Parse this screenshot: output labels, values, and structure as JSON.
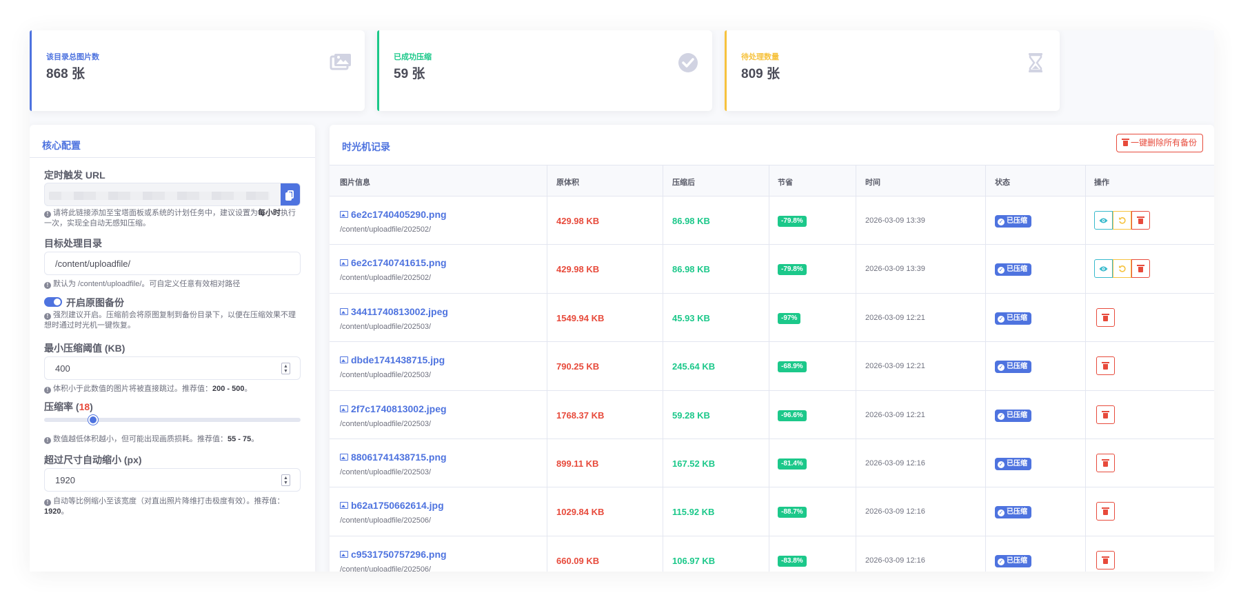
{
  "stats": [
    {
      "label": "该目录总图片数",
      "value": "868 张",
      "color": "#4e73df",
      "icon": "images-icon"
    },
    {
      "label": "已成功压缩",
      "value": "59 张",
      "color": "#1cc88a",
      "icon": "check-circle-icon"
    },
    {
      "label": "待处理数量",
      "value": "809 张",
      "color": "#f6c23e",
      "icon": "hourglass-icon"
    }
  ],
  "config": {
    "title": "核心配置",
    "cron_url": {
      "label": "定时触发 URL",
      "help_pre": "请将此链接添加至宝塔面板或系统的计划任务中，建议设置为",
      "help_bold": "每小时",
      "help_post": "执行一次，实现全自动无感知压缩。"
    },
    "target_dir": {
      "label": "目标处理目录",
      "value": "/content/uploadfile/",
      "help": "默认为 /content/uploadfile/。可自定义任意有效相对路径"
    },
    "backup": {
      "label": "开启原图备份",
      "enabled": true,
      "help": "强烈建议开启。压缩前会将原图复制到备份目录下，以便在压缩效果不理想时通过时光机一键恢复。"
    },
    "min_threshold": {
      "label": "最小压缩阈值 (KB)",
      "value": "400",
      "help_pre": "体积小于此数值的图片将被直接跳过。推荐值：",
      "help_bold": "200 - 500",
      "help_post": "。"
    },
    "rate": {
      "label_pre": "压缩率 (",
      "value": "18",
      "label_post": ")",
      "slider_fraction": 0.18,
      "help_pre": "数值越低体积越小，但可能出现画质损耗。推荐值：",
      "help_bold": "55 - 75",
      "help_post": "。"
    },
    "max_width": {
      "label": "超过尺寸自动缩小 (px)",
      "value": "1920",
      "help_pre": "自动等比例缩小至该宽度（对直出照片降维打击极度有效）。推荐值：",
      "help_bold": "1920",
      "help_post": "。"
    }
  },
  "history": {
    "title": "时光机记录",
    "delete_all_label": "一键删除所有备份",
    "columns": [
      "图片信息",
      "原体积",
      "压缩后",
      "节省",
      "时间",
      "状态",
      "操作"
    ],
    "rows": [
      {
        "name": "6e2c1740405290.png",
        "path": "/content/uploadfile/202502/",
        "orig": "429.98 KB",
        "comp": "86.98 KB",
        "save": "-79.8%",
        "time": "2026-03-09 13:39",
        "status": "已压缩",
        "has_backup": true
      },
      {
        "name": "6e2c1740741615.png",
        "path": "/content/uploadfile/202502/",
        "orig": "429.98 KB",
        "comp": "86.98 KB",
        "save": "-79.8%",
        "time": "2026-03-09 13:39",
        "status": "已压缩",
        "has_backup": true
      },
      {
        "name": "34411740813002.jpeg",
        "path": "/content/uploadfile/202503/",
        "orig": "1549.94 KB",
        "comp": "45.93 KB",
        "save": "-97%",
        "time": "2026-03-09 12:21",
        "status": "已压缩",
        "has_backup": false
      },
      {
        "name": "dbde1741438715.jpg",
        "path": "/content/uploadfile/202503/",
        "orig": "790.25 KB",
        "comp": "245.64 KB",
        "save": "-68.9%",
        "time": "2026-03-09 12:21",
        "status": "已压缩",
        "has_backup": false
      },
      {
        "name": "2f7c1740813002.jpeg",
        "path": "/content/uploadfile/202503/",
        "orig": "1768.37 KB",
        "comp": "59.28 KB",
        "save": "-96.6%",
        "time": "2026-03-09 12:21",
        "status": "已压缩",
        "has_backup": false
      },
      {
        "name": "88061741438715.png",
        "path": "/content/uploadfile/202503/",
        "orig": "899.11 KB",
        "comp": "167.52 KB",
        "save": "-81.4%",
        "time": "2026-03-09 12:16",
        "status": "已压缩",
        "has_backup": false
      },
      {
        "name": "b62a1750662614.jpg",
        "path": "/content/uploadfile/202506/",
        "orig": "1029.84 KB",
        "comp": "115.92 KB",
        "save": "-88.7%",
        "time": "2026-03-09 12:16",
        "status": "已压缩",
        "has_backup": false
      },
      {
        "name": "c9531750757296.png",
        "path": "/content/uploadfile/202506/",
        "orig": "660.09 KB",
        "comp": "106.97 KB",
        "save": "-83.8%",
        "time": "2026-03-09 12:16",
        "status": "已压缩",
        "has_backup": false
      }
    ]
  }
}
